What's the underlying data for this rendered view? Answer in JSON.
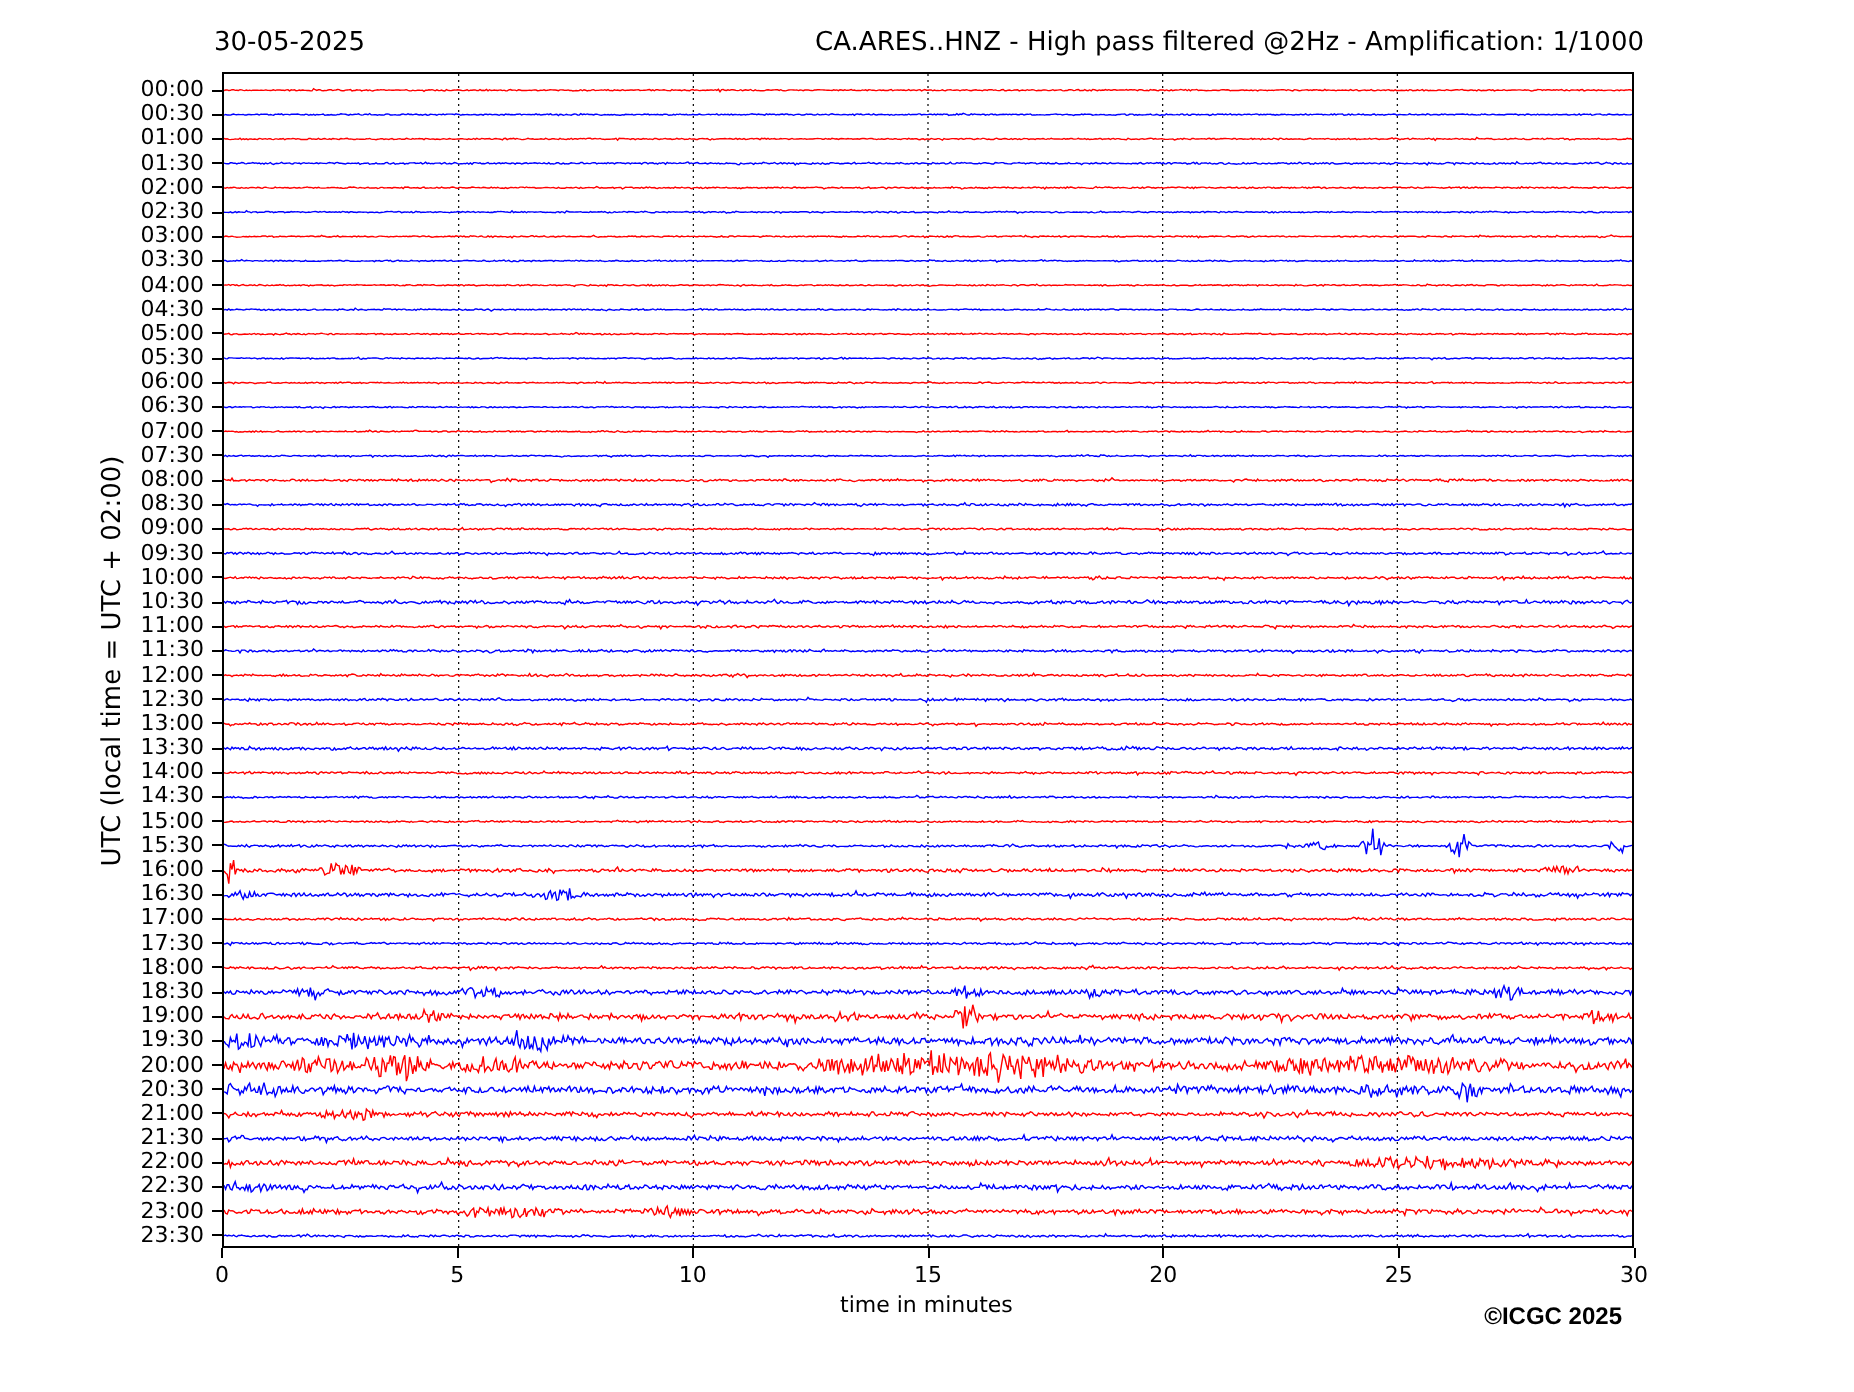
{
  "date": "30-05-2025",
  "title": "CA.ARES..HNZ - High pass filtered @2Hz - Amplification: 1/1000",
  "y_axis": {
    "label": "UTC (local time = UTC + 02:00)"
  },
  "x_axis": {
    "label": "time in minutes",
    "ticks": [
      "0",
      "5",
      "10",
      "15",
      "20",
      "25",
      "30"
    ]
  },
  "rows": [
    {
      "label": "00:00",
      "color": "#ff0000"
    },
    {
      "label": "00:30",
      "color": "#0000ff"
    },
    {
      "label": "01:00",
      "color": "#ff0000"
    },
    {
      "label": "01:30",
      "color": "#0000ff"
    },
    {
      "label": "02:00",
      "color": "#ff0000"
    },
    {
      "label": "02:30",
      "color": "#0000ff"
    },
    {
      "label": "03:00",
      "color": "#ff0000"
    },
    {
      "label": "03:30",
      "color": "#0000ff"
    },
    {
      "label": "04:00",
      "color": "#ff0000"
    },
    {
      "label": "04:30",
      "color": "#0000ff"
    },
    {
      "label": "05:00",
      "color": "#ff0000"
    },
    {
      "label": "05:30",
      "color": "#0000ff"
    },
    {
      "label": "06:00",
      "color": "#ff0000"
    },
    {
      "label": "06:30",
      "color": "#0000ff"
    },
    {
      "label": "07:00",
      "color": "#ff0000"
    },
    {
      "label": "07:30",
      "color": "#0000ff"
    },
    {
      "label": "08:00",
      "color": "#ff0000"
    },
    {
      "label": "08:30",
      "color": "#0000ff"
    },
    {
      "label": "09:00",
      "color": "#ff0000"
    },
    {
      "label": "09:30",
      "color": "#0000ff"
    },
    {
      "label": "10:00",
      "color": "#ff0000"
    },
    {
      "label": "10:30",
      "color": "#0000ff"
    },
    {
      "label": "11:00",
      "color": "#ff0000"
    },
    {
      "label": "11:30",
      "color": "#0000ff"
    },
    {
      "label": "12:00",
      "color": "#ff0000"
    },
    {
      "label": "12:30",
      "color": "#0000ff"
    },
    {
      "label": "13:00",
      "color": "#ff0000"
    },
    {
      "label": "13:30",
      "color": "#0000ff"
    },
    {
      "label": "14:00",
      "color": "#ff0000"
    },
    {
      "label": "14:30",
      "color": "#0000ff"
    },
    {
      "label": "15:00",
      "color": "#ff0000"
    },
    {
      "label": "15:30",
      "color": "#0000ff"
    },
    {
      "label": "16:00",
      "color": "#ff0000"
    },
    {
      "label": "16:30",
      "color": "#0000ff"
    },
    {
      "label": "17:00",
      "color": "#ff0000"
    },
    {
      "label": "17:30",
      "color": "#0000ff"
    },
    {
      "label": "18:00",
      "color": "#ff0000"
    },
    {
      "label": "18:30",
      "color": "#0000ff"
    },
    {
      "label": "19:00",
      "color": "#ff0000"
    },
    {
      "label": "19:30",
      "color": "#0000ff"
    },
    {
      "label": "20:00",
      "color": "#ff0000"
    },
    {
      "label": "20:30",
      "color": "#0000ff"
    },
    {
      "label": "21:00",
      "color": "#ff0000"
    },
    {
      "label": "21:30",
      "color": "#0000ff"
    },
    {
      "label": "22:00",
      "color": "#ff0000"
    },
    {
      "label": "22:30",
      "color": "#0000ff"
    },
    {
      "label": "23:00",
      "color": "#ff0000"
    },
    {
      "label": "23:30",
      "color": "#0000ff"
    }
  ],
  "copyright": "©ICGC 2025"
}
